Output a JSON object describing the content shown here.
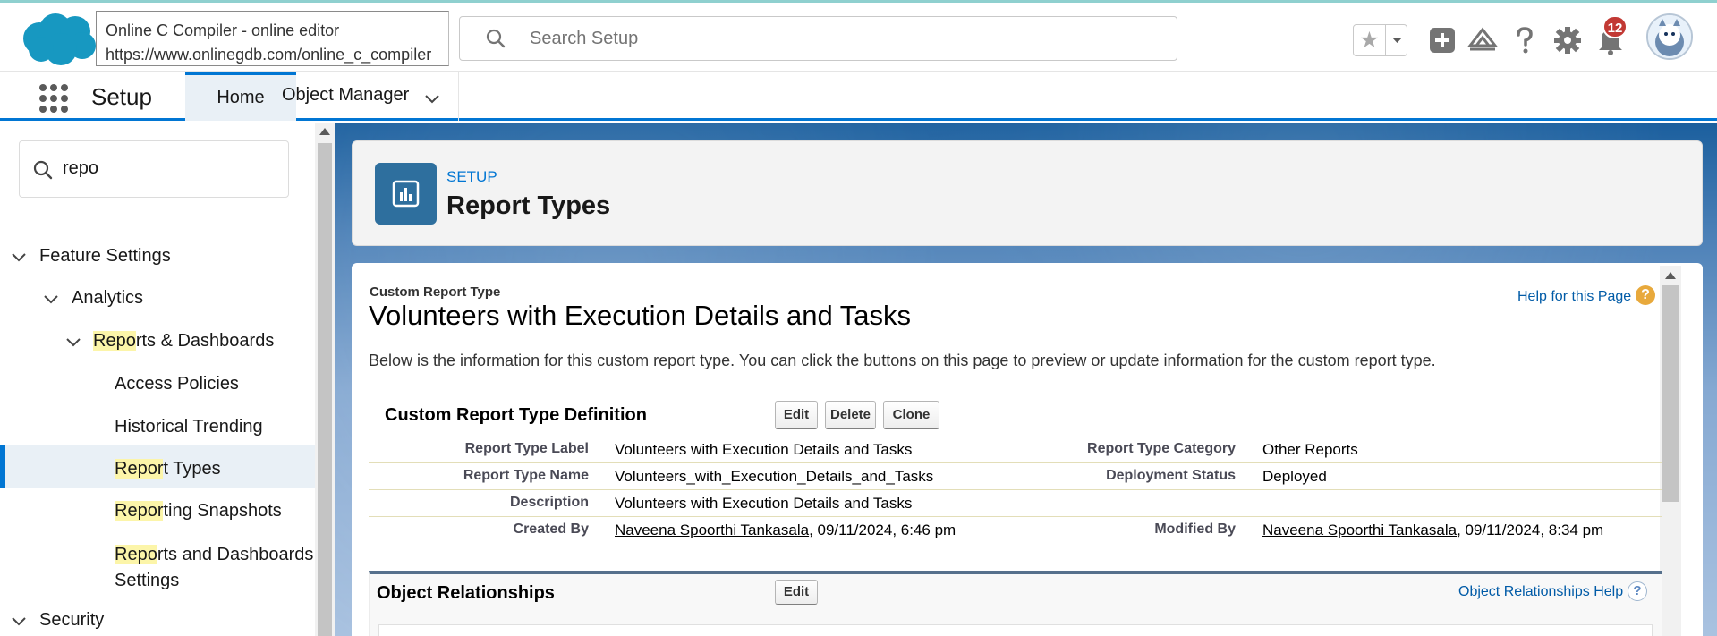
{
  "browser_tooltip": {
    "title": "Online C Compiler - online editor",
    "url": "https://www.onlinegdb.com/online_c_compiler"
  },
  "header": {
    "search_placeholder": "Search Setup",
    "notifications_count": "12"
  },
  "nav": {
    "app_name": "Setup",
    "tabs": [
      {
        "label": "Home",
        "active": true
      },
      {
        "label": "Object Manager",
        "active": false
      }
    ]
  },
  "sidebar": {
    "quick_find_value": "repo",
    "tree": {
      "feature_settings": "Feature Settings",
      "analytics": "Analytics",
      "reports_dashboards": {
        "highlight": "Repo",
        "rest": "rts & Dashboards"
      },
      "access_policies": "Access Policies",
      "historical_trending": "Historical Trending",
      "report_types": {
        "highlight": "Repor",
        "rest": "t Types",
        "selected": true
      },
      "reporting_snapshots": {
        "highlight": "Repor",
        "rest": "ting Snapshots"
      },
      "reports_dashboards_settings": {
        "highlight": "Repo",
        "rest": "rts and Dashboards",
        "line2": "Settings"
      },
      "security": "Security"
    }
  },
  "page_header": {
    "eyebrow": "SETUP",
    "title": "Report Types"
  },
  "content": {
    "crt_label": "Custom Report Type",
    "crt_title": "Volunteers with Execution Details and Tasks",
    "help_link": "Help for this Page",
    "intro": "Below is the information for this custom report type. You can click the buttons on this page to preview or update information for the custom report type.",
    "definition": {
      "title": "Custom Report Type Definition",
      "buttons": [
        "Edit",
        "Delete",
        "Clone"
      ],
      "rows": [
        {
          "l1": "Report Type Label",
          "v1": "Volunteers with Execution Details and Tasks",
          "l2": "Report Type Category",
          "v2": "Other Reports"
        },
        {
          "l1": "Report Type Name",
          "v1": "Volunteers_with_Execution_Details_and_Tasks",
          "l2": "Deployment Status",
          "v2": "Deployed"
        },
        {
          "l1": "Description",
          "v1": "Volunteers with Execution Details and Tasks",
          "l2": "",
          "v2": ""
        },
        {
          "l1": "Created By",
          "v1_link": "Naveena Spoorthi Tankasala",
          "v1_rest": ", 09/11/2024, 6:46 pm",
          "l2": "Modified By",
          "v2_link": "Naveena Spoorthi Tankasala",
          "v2_rest": ", 09/11/2024, 8:34 pm"
        }
      ]
    },
    "object_relationships": {
      "title": "Object Relationships",
      "button": "Edit",
      "help": "Object Relationships Help"
    }
  },
  "colors": {
    "brand_blue": "#0176d3",
    "cloud_blue": "#1798c1",
    "badge_red": "#c23934",
    "highlight_yellow": "#fcf5a9"
  },
  "icons": [
    "salesforce-cloud-logo",
    "search-icon",
    "star-icon",
    "chevron-down-icon",
    "plus-icon",
    "trailhead-icon",
    "help-icon",
    "gear-icon",
    "bell-icon",
    "avatar",
    "app-launcher-icon",
    "chart-icon"
  ]
}
